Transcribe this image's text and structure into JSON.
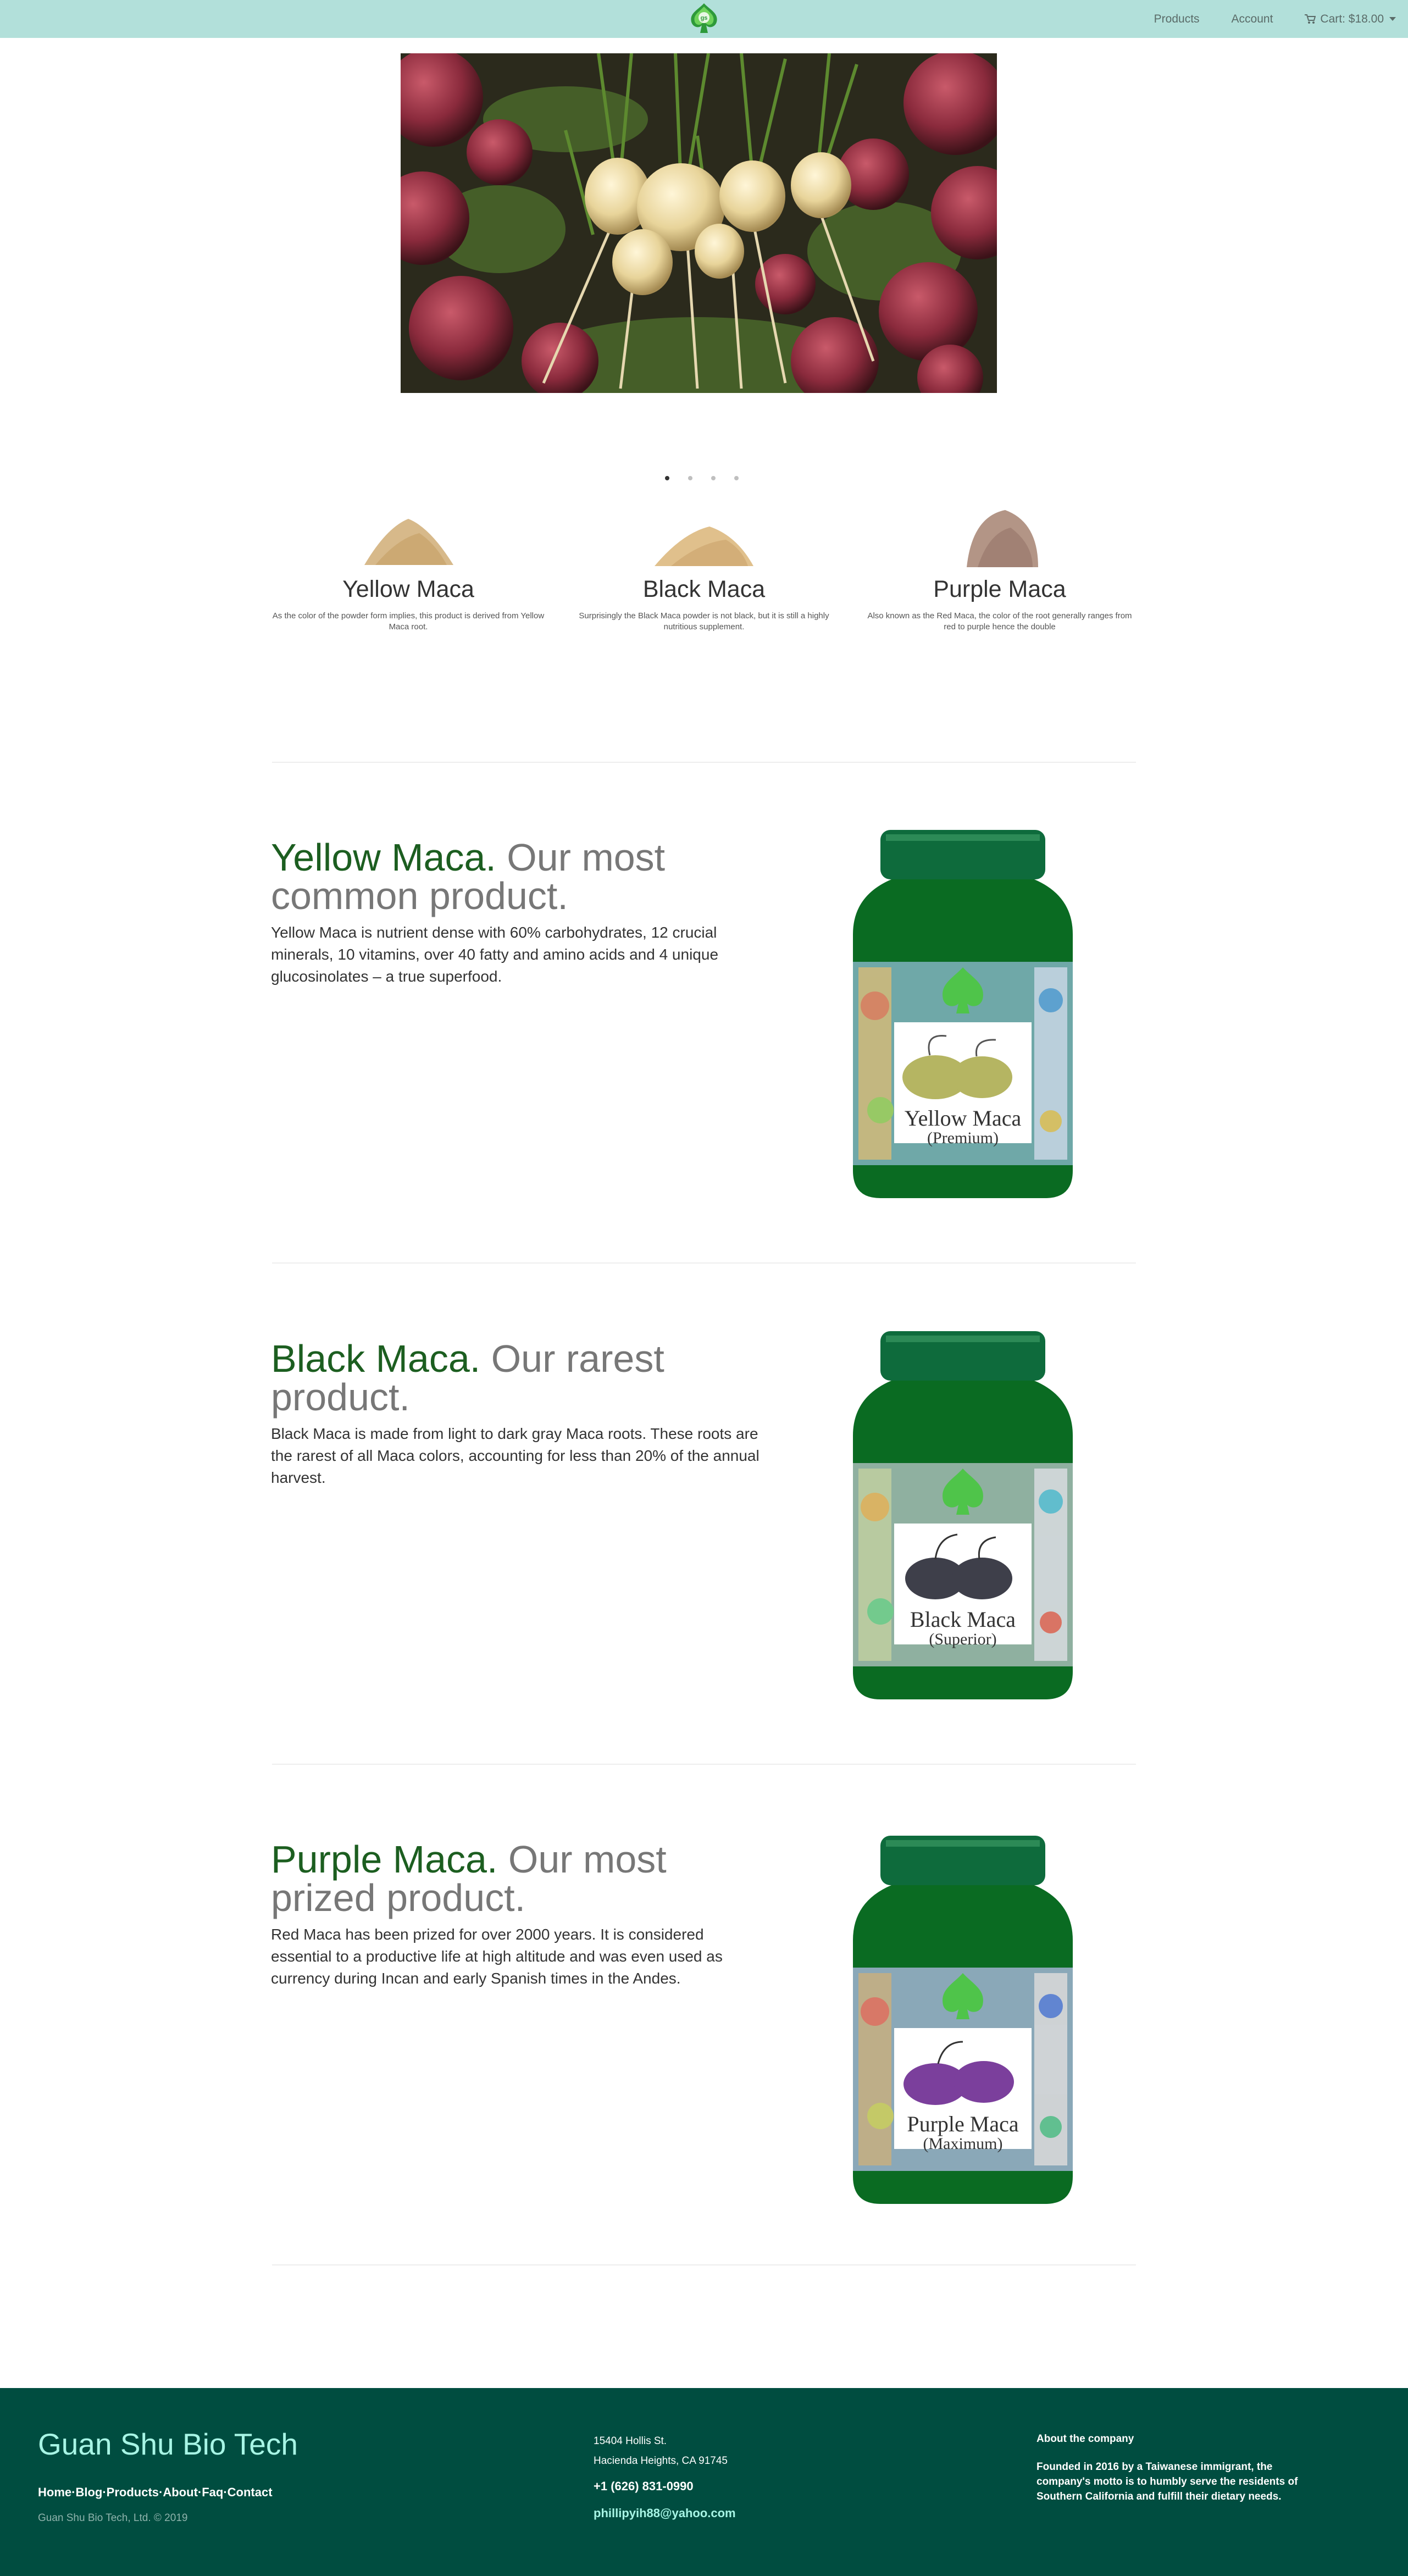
{
  "nav": {
    "products": "Products",
    "account": "Account",
    "cart": "Cart: $18.00",
    "logo_letters": "gs"
  },
  "carousel": {
    "hero_alt": "Maca roots",
    "slide_count": 4,
    "active_slide": 1
  },
  "products": [
    {
      "name": "Yellow Maca",
      "desc": "As the color of the powder form implies, this product is derived from Yellow Maca root.",
      "powder_color": "#d7b98a"
    },
    {
      "name": "Black Maca",
      "desc": "Surprisingly the Black Maca powder is not black, but it is still a highly nutritious supplement.",
      "powder_color": "#e0c08c"
    },
    {
      "name": "Purple Maca",
      "desc": "Also known as the Red Maca, the color of the root generally ranges from red to purple hence the double",
      "powder_color": "#b39586"
    }
  ],
  "features": [
    {
      "heading": "Yellow Maca.",
      "subheading": " Our most common product.",
      "text": "Yellow Maca is nutrient dense with 60% carbohydrates, 12 crucial minerals, 10 vitamins, over 40 fatty and amino acids and 4 unique glucosinolates – a true superfood.",
      "label_title": "Yellow Maca",
      "label_sub": "(Premium)",
      "root_color": "#b5b562"
    },
    {
      "heading": "Black Maca.",
      "subheading": " Our rarest product.",
      "text": "Black Maca is made from light to dark gray Maca roots. These roots are the rarest of all Maca colors, accounting for less than 20% of the annual harvest.",
      "label_title": "Black Maca",
      "label_sub": "(Superior)",
      "root_color": "#3e3f4a"
    },
    {
      "heading": "Purple Maca.",
      "subheading": " Our most prized product.",
      "text": "Red Maca has been prized for over 2000 years. It is considered essential to a productive life at high altitude and was even used as currency during Incan and early Spanish times in the Andes.",
      "label_title": "Purple Maca",
      "label_sub": "(Maximum)",
      "root_color": "#7b3f9c"
    }
  ],
  "footer": {
    "brand": "Guan Shu Bio Tech",
    "links": [
      "Home",
      "Blog",
      "Products",
      "About",
      "Faq",
      "Contact"
    ],
    "separator": "·",
    "copyright": "Guan Shu Bio Tech, Ltd. © 2019",
    "address_line1": "15404 Hollis St.",
    "address_line2": "Hacienda Heights, CA 91745",
    "phone": "+1 (626) 831-0990",
    "email": "phillipyih88@yahoo.com",
    "about_heading": "About the company",
    "about_text": "Founded in 2016 by a Taiwanese immigrant, the company's motto is to humbly serve the residents of Southern California and fulfill their dietary needs."
  },
  "colors": {
    "navbar": "#b2e0da",
    "footer": "#004d40",
    "accent_green": "#1c5e20",
    "brand_mint": "#a7f5e5"
  }
}
